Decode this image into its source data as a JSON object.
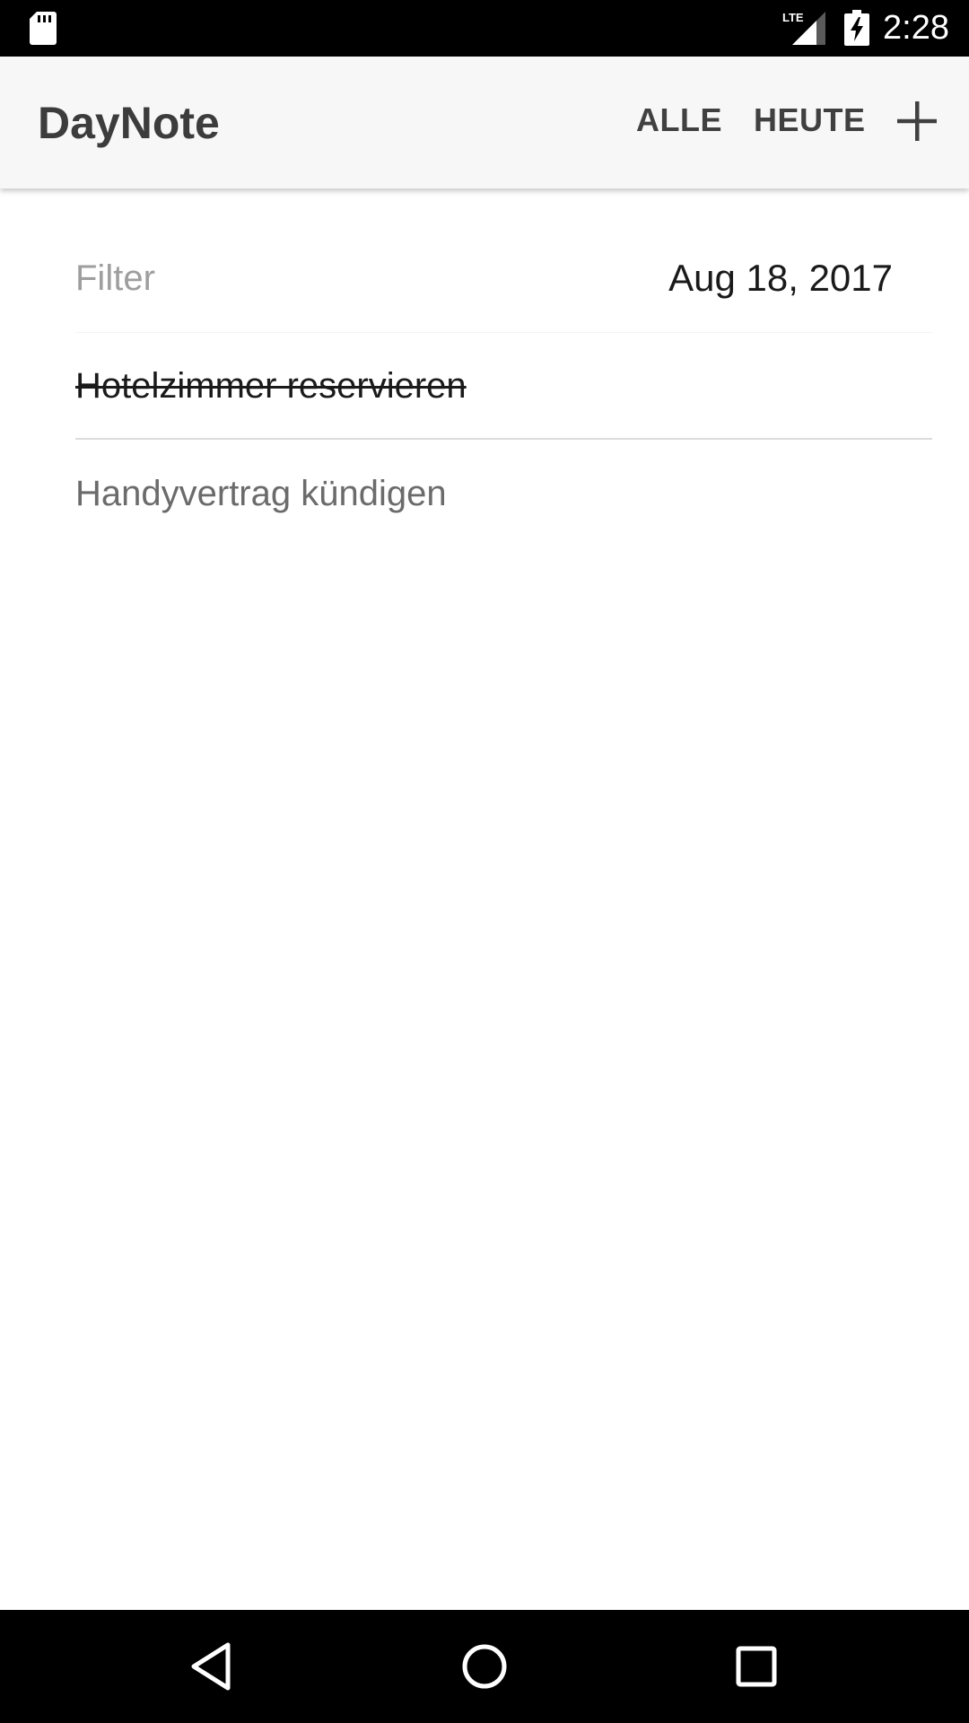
{
  "status_bar": {
    "time": "2:28",
    "network_label": "LTE",
    "icons": [
      "sd-card-icon",
      "lte-signal-icon",
      "battery-charging-icon"
    ]
  },
  "app_bar": {
    "title": "DayNote",
    "actions": {
      "all_label": "ALLE",
      "today_label": "HEUTE",
      "add_icon": "plus-icon"
    }
  },
  "filter": {
    "placeholder": "Filter",
    "value": ""
  },
  "date": "Aug 18, 2017",
  "notes": [
    {
      "text": "Hotelzimmer reservieren",
      "done": true
    },
    {
      "text": "Handyvertrag kündigen",
      "done": false
    }
  ],
  "nav_bar": {
    "icons": [
      "back-icon",
      "home-icon",
      "recents-icon"
    ]
  },
  "colors": {
    "app_bar_bg": "#f7f7f7",
    "status_bar_bg": "#000000",
    "title_text": "#3c3c3c",
    "placeholder_text": "#9e9e9e",
    "muted_note_text": "#6b6b6b",
    "divider": "#dcdcdc"
  }
}
